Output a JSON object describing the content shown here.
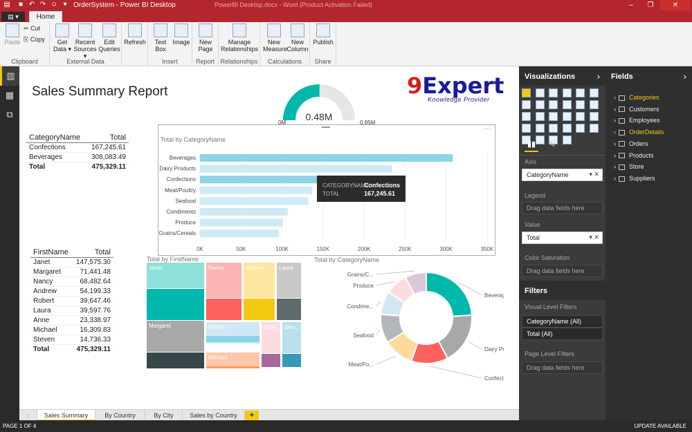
{
  "window": {
    "title": "OrderSystem - Power BI Desktop",
    "ghost_title": "PowerBI Desktop.docx - Word (Product Activation Failed)"
  },
  "tabs": {
    "file": "",
    "home": "Home"
  },
  "ribbon": {
    "groups": [
      {
        "label": "Clipboard",
        "buttons": [
          "Paste",
          "Cut",
          "Copy"
        ]
      },
      {
        "label": "External Data",
        "buttons": [
          "Get Data",
          "Recent Sources",
          "Edit Queries"
        ]
      },
      {
        "label": "",
        "buttons": [
          "Refresh"
        ]
      },
      {
        "label": "Insert",
        "buttons": [
          "Text Box",
          "Image"
        ]
      },
      {
        "label": "Report",
        "buttons": [
          "New Page"
        ]
      },
      {
        "label": "Relationships",
        "buttons": [
          "Manage Relationships"
        ]
      },
      {
        "label": "Calculations",
        "buttons": [
          "New Measure",
          "New Column"
        ]
      },
      {
        "label": "Share",
        "buttons": [
          "Publish"
        ]
      }
    ]
  },
  "report": {
    "title": "Sales Summary Report",
    "logo_main": "9Expert",
    "logo_sub": "Knowledge Provider",
    "gauge": {
      "value": "0.48M",
      "min": "0M",
      "max": "0.95M",
      "fraction": 0.505
    },
    "category_table": {
      "headers": [
        "CategoryName",
        "Total"
      ],
      "rows": [
        [
          "Confections",
          "167,245.61"
        ],
        [
          "Beverages",
          "308,083.49"
        ]
      ],
      "total": [
        "Total",
        "475,329.11"
      ]
    },
    "firstname_table": {
      "headers": [
        "FirstName",
        "Total"
      ],
      "rows": [
        [
          "Janet",
          "147,575.30"
        ],
        [
          "Margaret",
          "71,441.48"
        ],
        [
          "Nancy",
          "68,482.64"
        ],
        [
          "Andrew",
          "54,199.33"
        ],
        [
          "Robert",
          "39,647.46"
        ],
        [
          "Laura",
          "39,597.76"
        ],
        [
          "Anne",
          "23,338.97"
        ],
        [
          "Michael",
          "16,309.83"
        ],
        [
          "Steven",
          "14,736.33"
        ]
      ],
      "total": [
        "Total",
        "475,329.11"
      ]
    },
    "bar_title": "Total by CategoryName",
    "tooltip": {
      "k1": "CATEGORYNAME",
      "v1": "Confections",
      "k2": "TOTAL",
      "v2": "167,245.61"
    },
    "treemap_title": "Total by FirstName",
    "donut_title": "Total by CategoryName"
  },
  "chart_data": [
    {
      "type": "bar",
      "title": "Total by CategoryName",
      "categories": [
        "Beverages",
        "Dairy Products",
        "Confections",
        "Meat/Poultry",
        "Seafood",
        "Condiments",
        "Produce",
        "Grains/Cereals"
      ],
      "values": [
        308083.49,
        234000,
        167245.61,
        137000,
        132000,
        107000,
        101000,
        96000
      ],
      "ticks": [
        "0K",
        "50K",
        "100K",
        "150K",
        "200K",
        "250K",
        "300K",
        "350K"
      ],
      "xlim": [
        0,
        350000
      ],
      "highlight": "Confections"
    },
    {
      "type": "treemap",
      "title": "Total by FirstName",
      "labels": [
        "Janet",
        "Nancy",
        "Andrew",
        "Laura",
        "Margaret",
        "Robert",
        "Anne",
        "Stev...",
        "Michael"
      ]
    },
    {
      "type": "pie",
      "title": "Total by CategoryName",
      "labels": [
        "Beverag...",
        "Dairy Pr...",
        "Confecti...",
        "Meat/Po...",
        "Seafood",
        "Condime...",
        "Produce",
        "Grains/C..."
      ],
      "values": [
        308083.49,
        234000,
        167245.61,
        137000,
        132000,
        107000,
        101000,
        96000
      ],
      "colors": [
        "#01b8aa",
        "#a8a8a8",
        "#fd625e",
        "#fdd99a",
        "#b4b7b9",
        "#d1e8f4",
        "#fddce0",
        "#dac8d8"
      ]
    }
  ],
  "page_tabs": [
    "Sales Summary",
    "By Country",
    "By City",
    "Sales by Country"
  ],
  "add_tab": "+",
  "status": {
    "left": "PAGE 1 OF 4",
    "right": "UPDATE AVAILABLE"
  },
  "viz": {
    "header": "Visualizations",
    "axis_label": "Axis",
    "axis_value": "CategoryName",
    "legend_label": "Legend",
    "legend_placeholder": "Drag data fields here",
    "value_label": "Value",
    "value_value": "Total",
    "colorsat_label": "Color Saturation",
    "colorsat_placeholder": "Drag data fields here",
    "filters_header": "Filters",
    "visual_filters_label": "Visual Level Filters",
    "filter1": "CategoryName (All)",
    "filter2": "Total (All)",
    "page_filters_label": "Page Level Filters",
    "page_filters_placeholder": "Drag data fields here"
  },
  "fields": {
    "header": "Fields",
    "items": [
      "Categories",
      "Customers",
      "Employees",
      "OrderDetails",
      "Orders",
      "Products",
      "Store",
      "Suppliers"
    ],
    "selected": [
      "Categories",
      "OrderDetails"
    ]
  }
}
